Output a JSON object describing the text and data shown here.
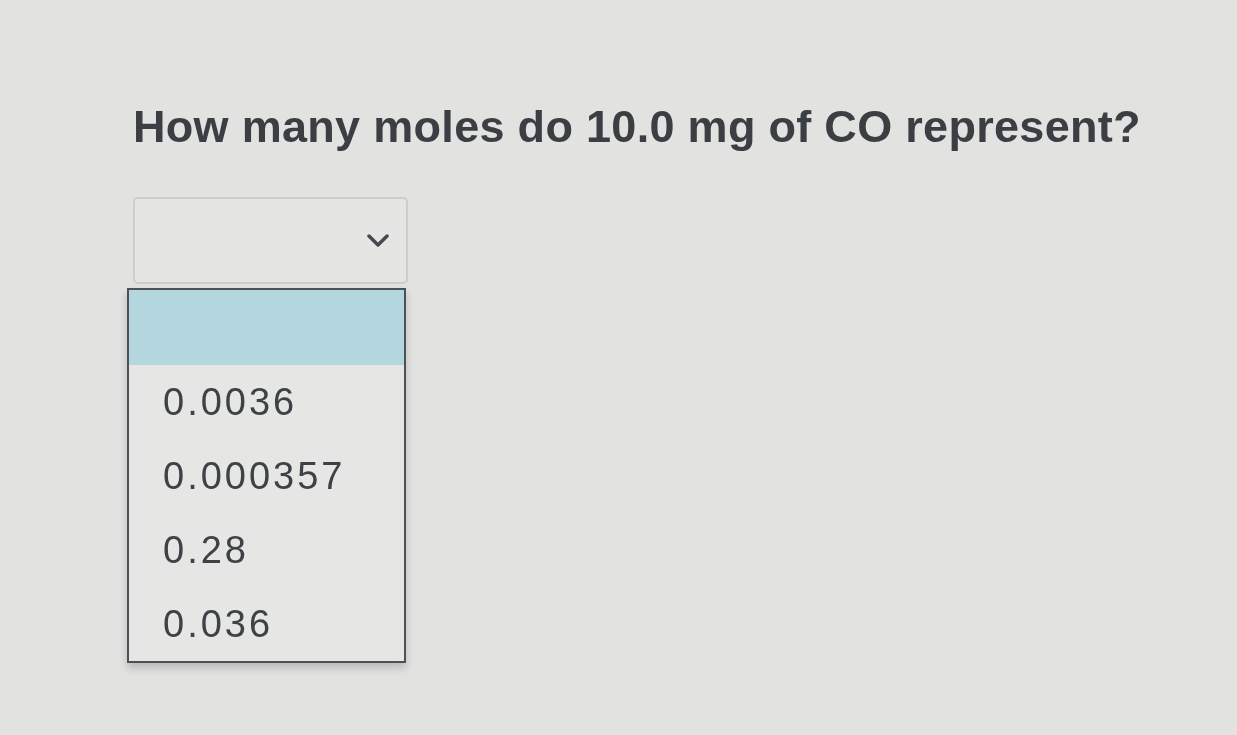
{
  "question": {
    "text": "How many moles do 10.0 mg of CO represent?"
  },
  "dropdown": {
    "expanded": true,
    "options": [
      {
        "kind": "blank",
        "selected": true
      },
      {
        "kind": "value",
        "label": "0.0036",
        "selected": false
      },
      {
        "kind": "value",
        "label": "0.000357",
        "selected": false
      },
      {
        "kind": "value",
        "label": "0.28",
        "selected": false
      },
      {
        "kind": "value",
        "label": "0.036",
        "selected": false
      }
    ]
  }
}
